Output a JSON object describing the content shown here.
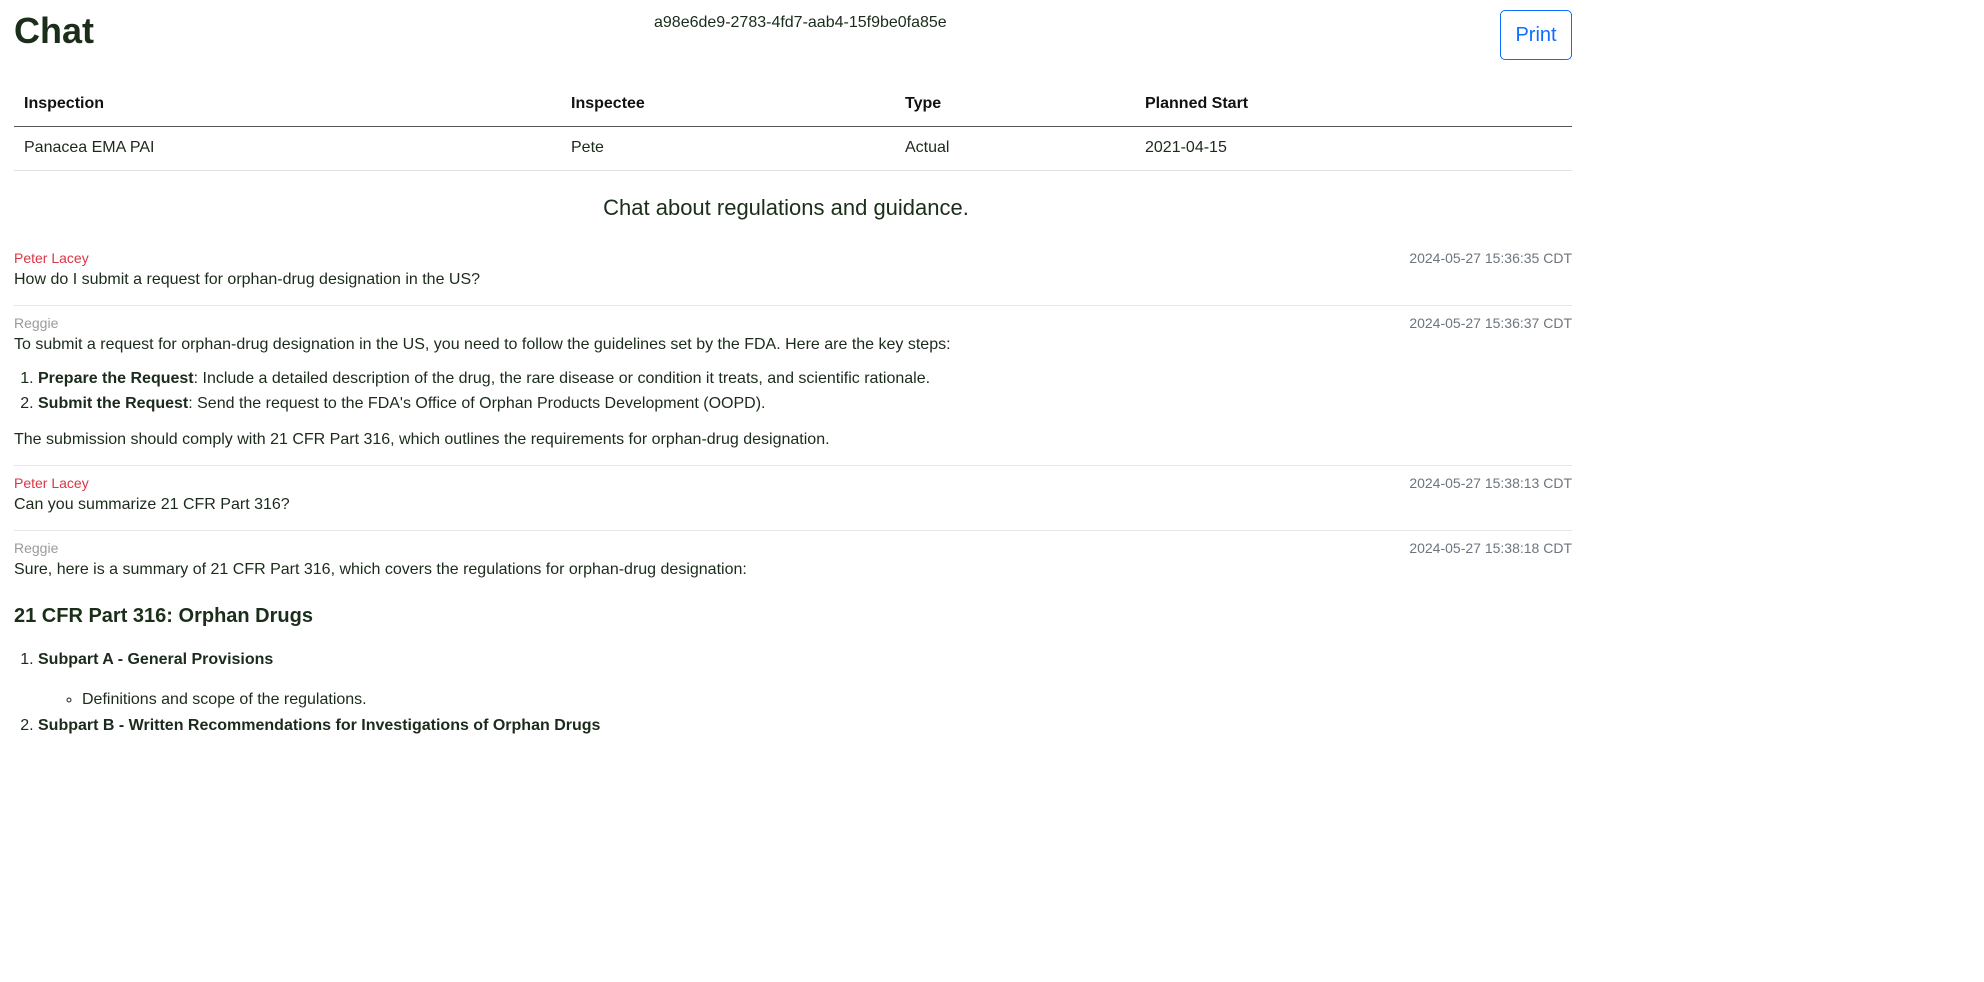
{
  "header": {
    "title": "Chat",
    "uuid": "a98e6de9-2783-4fd7-aab4-15f9be0fa85e",
    "print_label": "Print"
  },
  "inspection_table": {
    "columns": [
      "Inspection",
      "Inspectee",
      "Type",
      "Planned Start"
    ],
    "row": {
      "inspection": "Panacea EMA PAI",
      "inspectee": "Pete",
      "type": "Actual",
      "planned_start": "2021-04-15"
    }
  },
  "chat_subtitle": "Chat about regulations and guidance.",
  "messages": [
    {
      "author": "Peter Lacey",
      "timestamp": "2024-05-27 15:36:35 CDT",
      "text": "How do I submit a request for orphan-drug designation in the US?"
    },
    {
      "author": "Reggie",
      "timestamp": "2024-05-27 15:36:37 CDT",
      "intro": "To submit a request for orphan-drug designation in the US, you need to follow the guidelines set by the FDA. Here are the key steps:",
      "steps": [
        {
          "bold": "Prepare the Request",
          "text": ": Include a detailed description of the drug, the rare disease or condition it treats, and scientific rationale."
        },
        {
          "bold": "Submit the Request",
          "text": ": Send the request to the FDA's Office of Orphan Products Development (OOPD)."
        }
      ],
      "outro": "The submission should comply with 21 CFR Part 316, which outlines the requirements for orphan-drug designation."
    },
    {
      "author": "Peter Lacey",
      "timestamp": "2024-05-27 15:38:13 CDT",
      "text": "Can you summarize 21 CFR Part 316?"
    },
    {
      "author": "Reggie",
      "timestamp": "2024-05-27 15:38:18 CDT",
      "intro": "Sure, here is a summary of 21 CFR Part 316, which covers the regulations for orphan-drug designation:",
      "heading": "21 CFR Part 316: Orphan Drugs",
      "subparts": [
        {
          "title": "Subpart A - General Provisions",
          "bullets": [
            "Definitions and scope of the regulations."
          ]
        },
        {
          "title": "Subpart B - Written Recommendations for Investigations of Orphan Drugs",
          "bullets": []
        }
      ]
    }
  ]
}
